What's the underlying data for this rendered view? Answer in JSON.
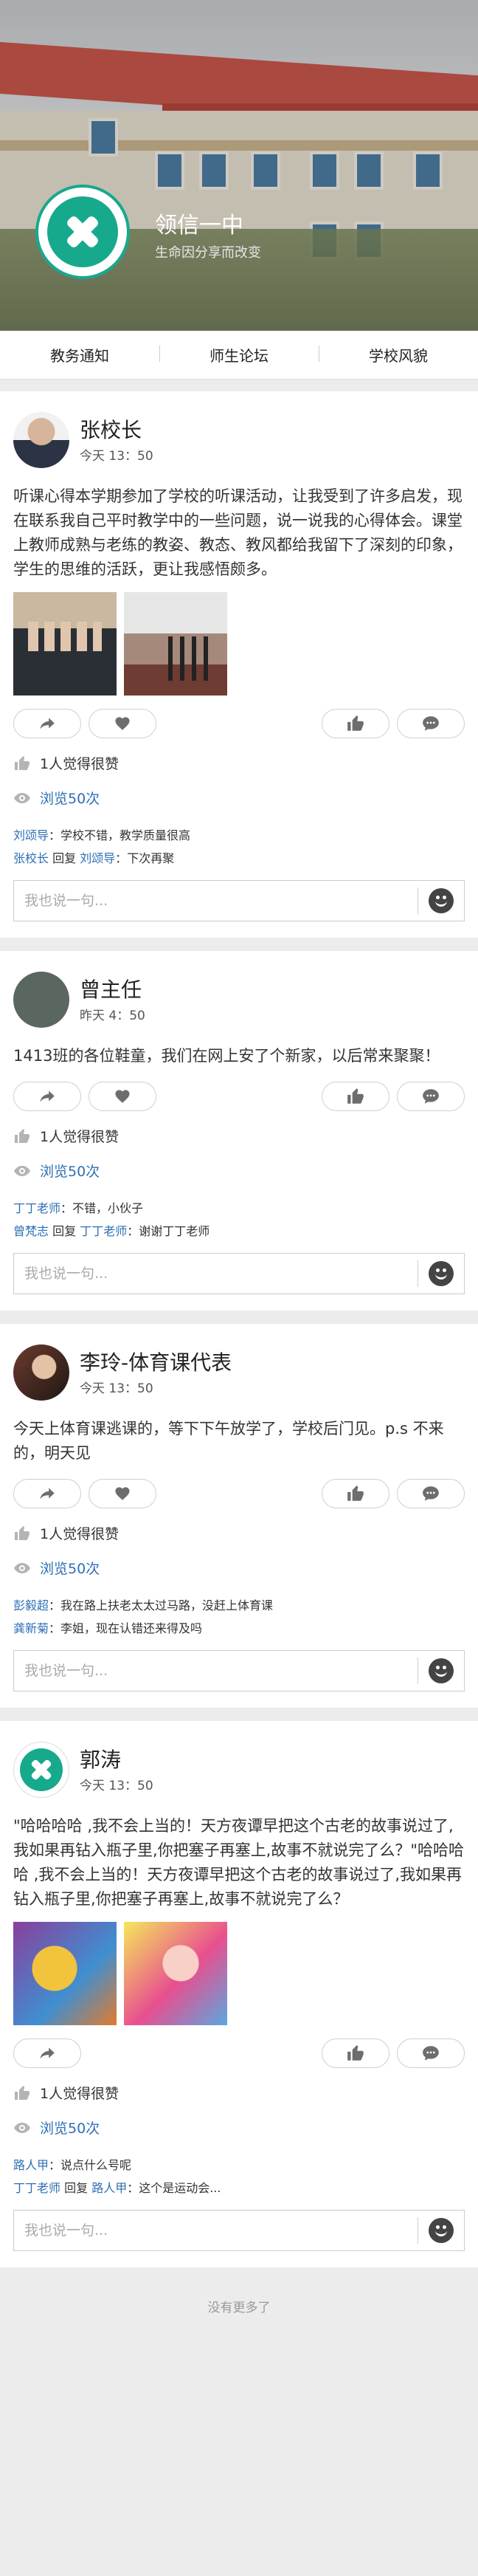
{
  "school": {
    "name": "领信一中",
    "subtitle": "生命因分享而改变"
  },
  "nav": {
    "items": [
      "教务通知",
      "师生论坛",
      "学校风貌"
    ]
  },
  "posts": [
    {
      "author": "张校长",
      "time": "今天 13：50",
      "content": "听课心得本学期参加了学校的听课活动，让我受到了许多启发，现在联系我自己平时教学中的一些问题，说一说我的心得体会。课堂上教师成熟与老练的教姿、教态、教风都给我留下了深刻的印象，学生的思维的活跃，更让我感悟颇多。",
      "likes": "1人觉得很赞",
      "views": "浏览50次",
      "comments": [
        {
          "name": "刘颂导",
          "text": "：学校不错，教学质量很高"
        },
        {
          "name": "张校长",
          "reply_word": " 回复 ",
          "target": "刘颂导",
          "text": "：下次再聚"
        }
      ],
      "reply_placeholder": "我也说一句..."
    },
    {
      "author": "曾主任",
      "time": "昨天 4：50",
      "content": "1413班的各位鞋童，我们在网上安了个新家，以后常来聚聚！",
      "likes": "1人觉得很赞",
      "views": "浏览50次",
      "comments": [
        {
          "name": "丁丁老师",
          "text": "：不错，小伙子"
        },
        {
          "name": "曾梵志",
          "reply_word": " 回复 ",
          "target": "丁丁老师",
          "text": "：谢谢丁丁老师"
        }
      ],
      "reply_placeholder": "我也说一句..."
    },
    {
      "author": "李玲-体育课代表",
      "time": "今天 13：50",
      "content": "今天上体育课逃课的，等下下午放学了，学校后门见。p.s 不来的，明天见",
      "likes": "1人觉得很赞",
      "views": "浏览50次",
      "comments": [
        {
          "name": "彭毅超",
          "text": "：我在路上扶老太太过马路，没赶上体育课"
        },
        {
          "name": "龚新菊",
          "text": "：李姐，现在认错还来得及吗"
        }
      ],
      "reply_placeholder": "我也说一句..."
    },
    {
      "author": "郭涛",
      "time": "今天 13：50",
      "content": "\"哈哈哈哈 ,我不会上当的！天方夜谭早把这个古老的故事说过了,我如果再钻入瓶子里,你把塞子再塞上,故事不就说完了么？\"哈哈哈哈 ,我不会上当的！天方夜谭早把这个古老的故事说过了,我如果再钻入瓶子里,你把塞子再塞上,故事不就说完了么？",
      "likes": "1人觉得很赞",
      "views": "浏览50次",
      "comments": [
        {
          "name": "路人甲",
          "text": "：说点什么号呢"
        },
        {
          "name": "丁丁老师",
          "reply_word": " 回复 ",
          "target": "路人甲",
          "text": "：这个是运动会..."
        }
      ],
      "reply_placeholder": "我也说一句..."
    }
  ],
  "footer": {
    "text": "没有更多了"
  },
  "icons": {
    "share": "share-arrow-icon",
    "favorite": "heart-icon",
    "like": "thumbs-up-icon",
    "comment": "speech-bubble-icon",
    "view": "eye-icon",
    "emoji": "smiley-icon"
  },
  "colors": {
    "accent": "#2e6fb5",
    "brand": "#17a98c"
  }
}
